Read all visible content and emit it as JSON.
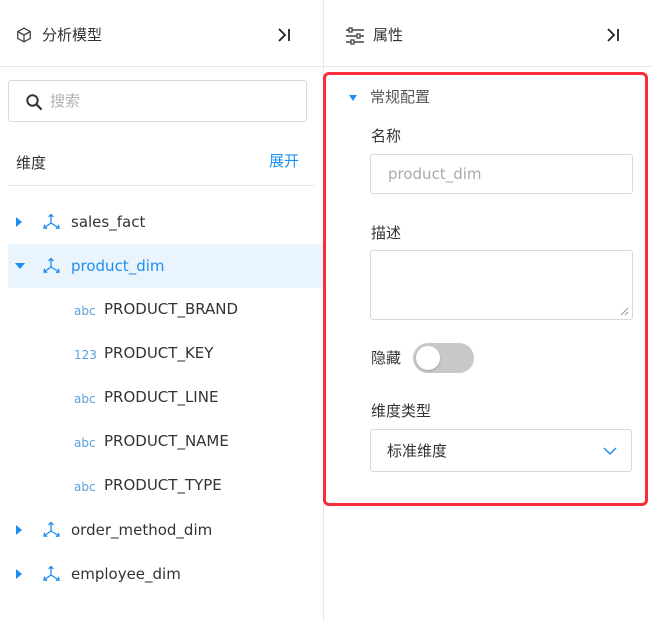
{
  "left_panel": {
    "title": "分析模型",
    "search_placeholder": "搜索",
    "section_label": "维度",
    "expand_label": "展开",
    "tree": [
      {
        "label": "sales_fact",
        "expanded": false,
        "selected": false
      },
      {
        "label": "product_dim",
        "expanded": true,
        "selected": true,
        "fields": [
          {
            "type": "abc",
            "name": "PRODUCT_BRAND"
          },
          {
            "type": "123",
            "name": "PRODUCT_KEY"
          },
          {
            "type": "abc",
            "name": "PRODUCT_LINE"
          },
          {
            "type": "abc",
            "name": "PRODUCT_NAME"
          },
          {
            "type": "abc",
            "name": "PRODUCT_TYPE"
          }
        ]
      },
      {
        "label": "order_method_dim",
        "expanded": false,
        "selected": false
      },
      {
        "label": "employee_dim",
        "expanded": false,
        "selected": false
      }
    ]
  },
  "right_panel": {
    "title": "属性",
    "group_title": "常规配置",
    "name_label": "名称",
    "name_value": "product_dim",
    "desc_label": "描述",
    "desc_value": "",
    "hidden_label": "隐藏",
    "hidden_on": false,
    "dimension_type_label": "维度类型",
    "dimension_type_value": "标准维度"
  },
  "colors": {
    "accent": "#1e8ef0",
    "highlight_border": "#f52e3a",
    "selected_row_bg": "#eaf4fd",
    "border": "#d9d9d9",
    "toggle_off": "#c8c8c8"
  }
}
